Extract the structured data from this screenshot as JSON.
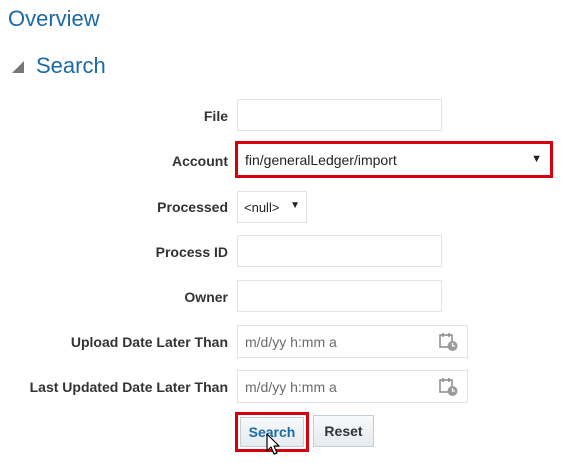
{
  "header": {
    "title": "Overview",
    "section_title": "Search"
  },
  "form": {
    "file": {
      "label": "File",
      "value": ""
    },
    "account": {
      "label": "Account",
      "value": "fin/generalLedger/import"
    },
    "processed": {
      "label": "Processed",
      "value": "<null>"
    },
    "process_id": {
      "label": "Process ID",
      "value": ""
    },
    "owner": {
      "label": "Owner",
      "value": ""
    },
    "upload_date": {
      "label": "Upload Date Later Than",
      "placeholder": "m/d/yy h:mm a"
    },
    "last_updated_date": {
      "label": "Last Updated Date Later Than",
      "placeholder": "m/d/yy h:mm a"
    }
  },
  "buttons": {
    "search": "Search",
    "reset": "Reset"
  },
  "icons": {
    "collapse": "collapse-triangle-icon",
    "dropdown": "chevron-down-icon",
    "calendar": "calendar-icon",
    "cursor": "mouse-pointer-icon"
  },
  "colors": {
    "link_blue": "#1b6aa8",
    "highlight_red": "#d8000c"
  }
}
